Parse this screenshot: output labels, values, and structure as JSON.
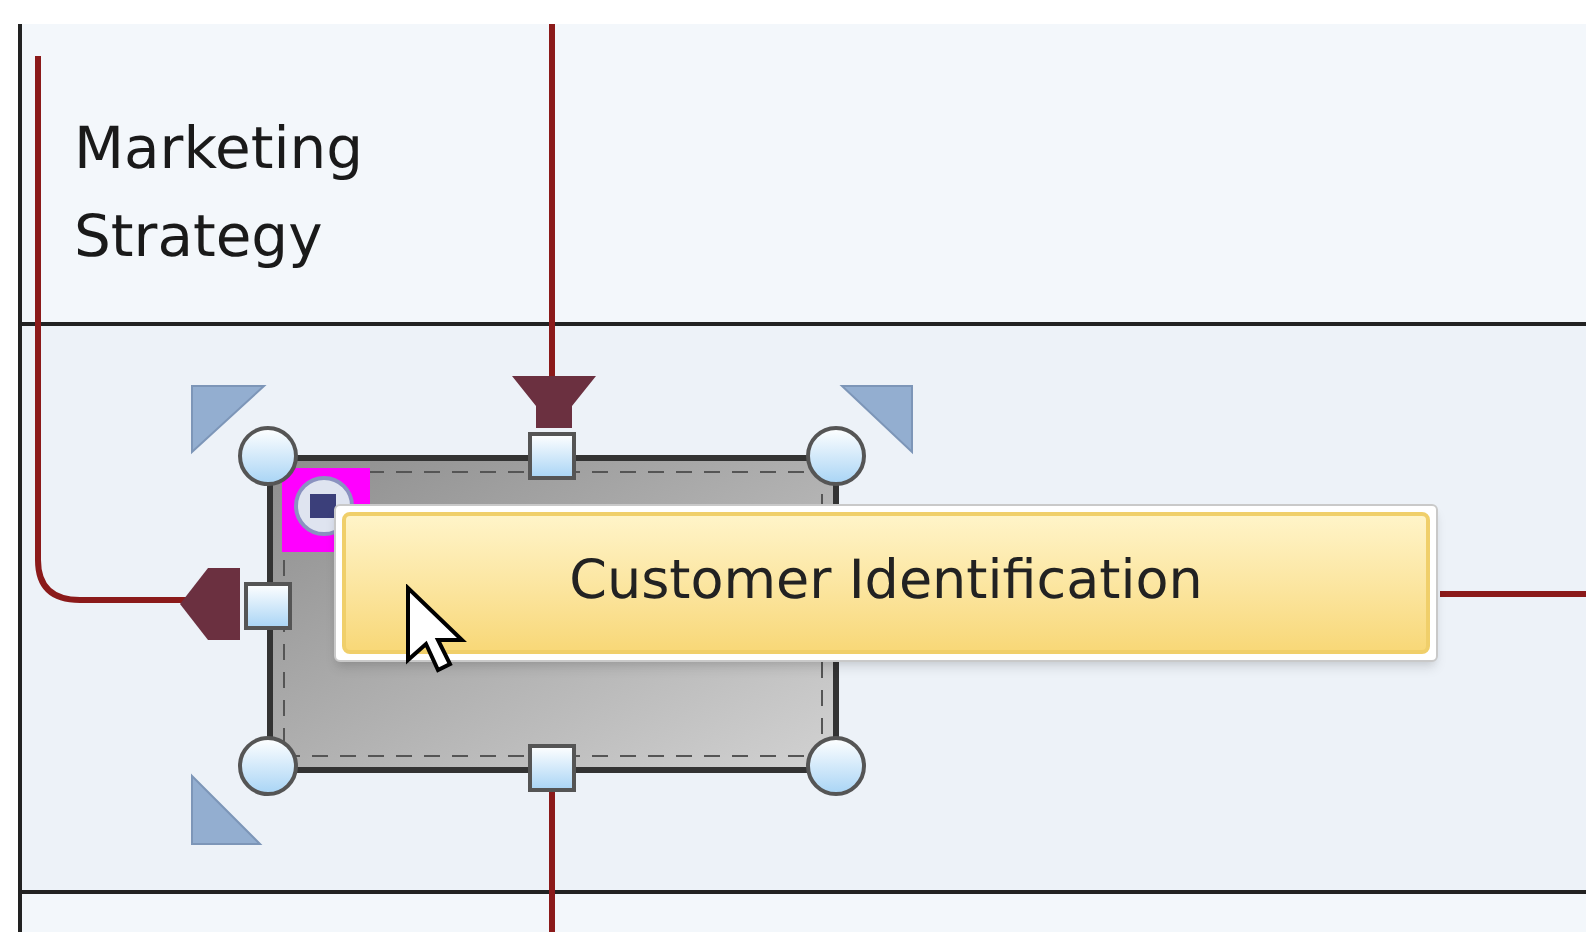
{
  "lane": {
    "label": "Marketing Strategy"
  },
  "tooltip": {
    "text": "Customer Identification"
  }
}
